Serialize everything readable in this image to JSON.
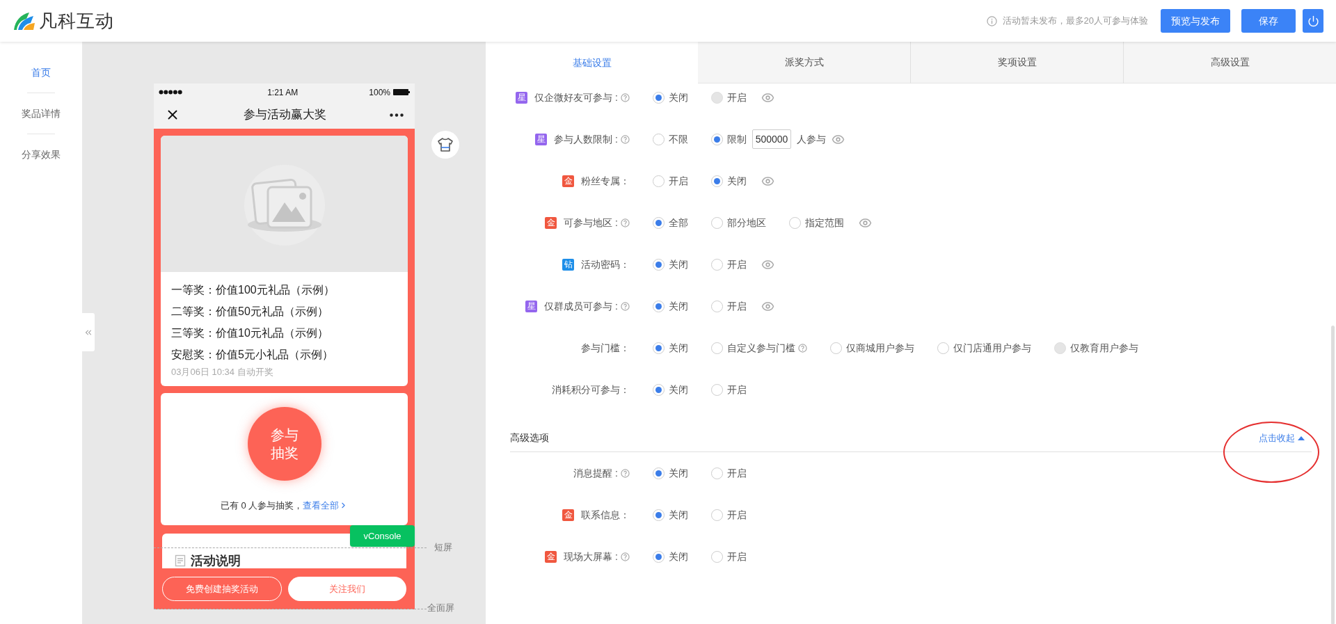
{
  "header": {
    "logo": "凡科互动",
    "notice": "活动暂未发布，最多20人可参与体验",
    "buttons": [
      {
        "label": "预览与发布"
      },
      {
        "label": "保存"
      }
    ]
  },
  "sidebar": {
    "items": [
      {
        "label": "首页",
        "selected": true
      },
      {
        "label": "奖品详情",
        "selected": false
      },
      {
        "label": "分享效果",
        "selected": false
      }
    ]
  },
  "phone": {
    "time": "1:21 AM",
    "battery": "100%",
    "title": "参与活动赢大奖",
    "prizes": [
      "一等奖：价值100元礼品（示例）",
      "二等奖：价值50元礼品（示例）",
      "三等奖：价值10元礼品（示例）",
      "安慰奖：价值5元小礼品（示例）"
    ],
    "draw_time": "03月06日 10:34 自动开奖",
    "draw_button": "参与抽奖",
    "participants": "已有 0 人参与抽奖，",
    "view_all": "查看全部",
    "section_title": "活动说明",
    "footer_buttons": [
      {
        "label": "免费创建抽奖活动",
        "kind": "outline"
      },
      {
        "label": "关注我们",
        "kind": "solid"
      }
    ],
    "vconsole": "vConsole"
  },
  "screen_marks": [
    "短屏",
    "全面屏"
  ],
  "tabs": [
    {
      "label": "基础设置",
      "selected": true
    },
    {
      "label": "派奖方式",
      "selected": false
    },
    {
      "label": "奖项设置",
      "selected": false
    },
    {
      "label": "高级设置",
      "selected": false
    }
  ],
  "settings": [
    {
      "label": "仅企微好友可参与 :",
      "badge": {
        "text": "星",
        "color": "#9466ee"
      },
      "help": true,
      "preview": true,
      "options": [
        {
          "label": "关闭",
          "selected": true,
          "disabled": false
        },
        {
          "label": "开启",
          "selected": false,
          "disabled": true
        }
      ]
    },
    {
      "label": "参与人数限制 :",
      "badge": {
        "text": "星",
        "color": "#9466ee"
      },
      "help": true,
      "preview": true,
      "options": [
        {
          "label": "不限",
          "selected": false,
          "disabled": false
        },
        {
          "label": "限制",
          "selected": true,
          "disabled": false
        }
      ],
      "input": "500000",
      "suffix": "人参与"
    },
    {
      "label": "粉丝专属：",
      "badge": {
        "text": "金",
        "color": "#f0573f"
      },
      "help": false,
      "preview": true,
      "options": [
        {
          "label": "开启",
          "selected": false,
          "disabled": false
        },
        {
          "label": "关闭",
          "selected": true,
          "disabled": false
        }
      ]
    },
    {
      "label": "可参与地区 :",
      "badge": {
        "text": "金",
        "color": "#f0573f"
      },
      "help": true,
      "preview": true,
      "options": [
        {
          "label": "全部",
          "selected": true,
          "disabled": false
        },
        {
          "label": "部分地区",
          "selected": false,
          "disabled": false
        },
        {
          "label": "指定范围",
          "selected": false,
          "disabled": false
        }
      ]
    },
    {
      "label": "活动密码：",
      "badge": {
        "text": "钻",
        "color": "#1e8ee8"
      },
      "help": false,
      "preview": true,
      "options": [
        {
          "label": "关闭",
          "selected": true,
          "disabled": false
        },
        {
          "label": "开启",
          "selected": false,
          "disabled": false
        }
      ]
    },
    {
      "label": "仅群成员可参与 :",
      "badge": {
        "text": "星",
        "color": "#9466ee"
      },
      "help": true,
      "preview": true,
      "options": [
        {
          "label": "关闭",
          "selected": true,
          "disabled": false
        },
        {
          "label": "开启",
          "selected": false,
          "disabled": false
        }
      ]
    },
    {
      "label": "参与门槛：",
      "help": false,
      "preview": false,
      "options": [
        {
          "label": "关闭",
          "selected": true,
          "disabled": false
        },
        {
          "label": "自定义参与门槛",
          "selected": false,
          "disabled": false,
          "help": true
        },
        {
          "label": "仅商城用户参与",
          "selected": false,
          "disabled": false
        },
        {
          "label": "仅门店通用户参与",
          "selected": false,
          "disabled": false
        },
        {
          "label": "仅教育用户参与",
          "selected": false,
          "disabled": true
        }
      ]
    },
    {
      "label": "消耗积分可参与：",
      "help": false,
      "preview": false,
      "options": [
        {
          "label": "关闭",
          "selected": true,
          "disabled": false
        },
        {
          "label": "开启",
          "selected": false,
          "disabled": false
        }
      ]
    }
  ],
  "advanced": {
    "title": "高级选项",
    "toggle": "点击收起",
    "settings": [
      {
        "label": "消息提醒 :",
        "help": true,
        "preview": false,
        "options": [
          {
            "label": "关闭",
            "selected": true,
            "disabled": false
          },
          {
            "label": "开启",
            "selected": false,
            "disabled": false
          }
        ]
      },
      {
        "label": "联系信息：",
        "badge": {
          "text": "金",
          "color": "#f0573f"
        },
        "help": false,
        "preview": false,
        "options": [
          {
            "label": "关闭",
            "selected": true,
            "disabled": false
          },
          {
            "label": "开启",
            "selected": false,
            "disabled": false
          }
        ]
      },
      {
        "label": "现场大屏幕 :",
        "badge": {
          "text": "金",
          "color": "#f0573f"
        },
        "help": true,
        "preview": false,
        "options": [
          {
            "label": "关闭",
            "selected": true,
            "disabled": false
          },
          {
            "label": "开启",
            "selected": false,
            "disabled": false
          }
        ]
      }
    ]
  }
}
